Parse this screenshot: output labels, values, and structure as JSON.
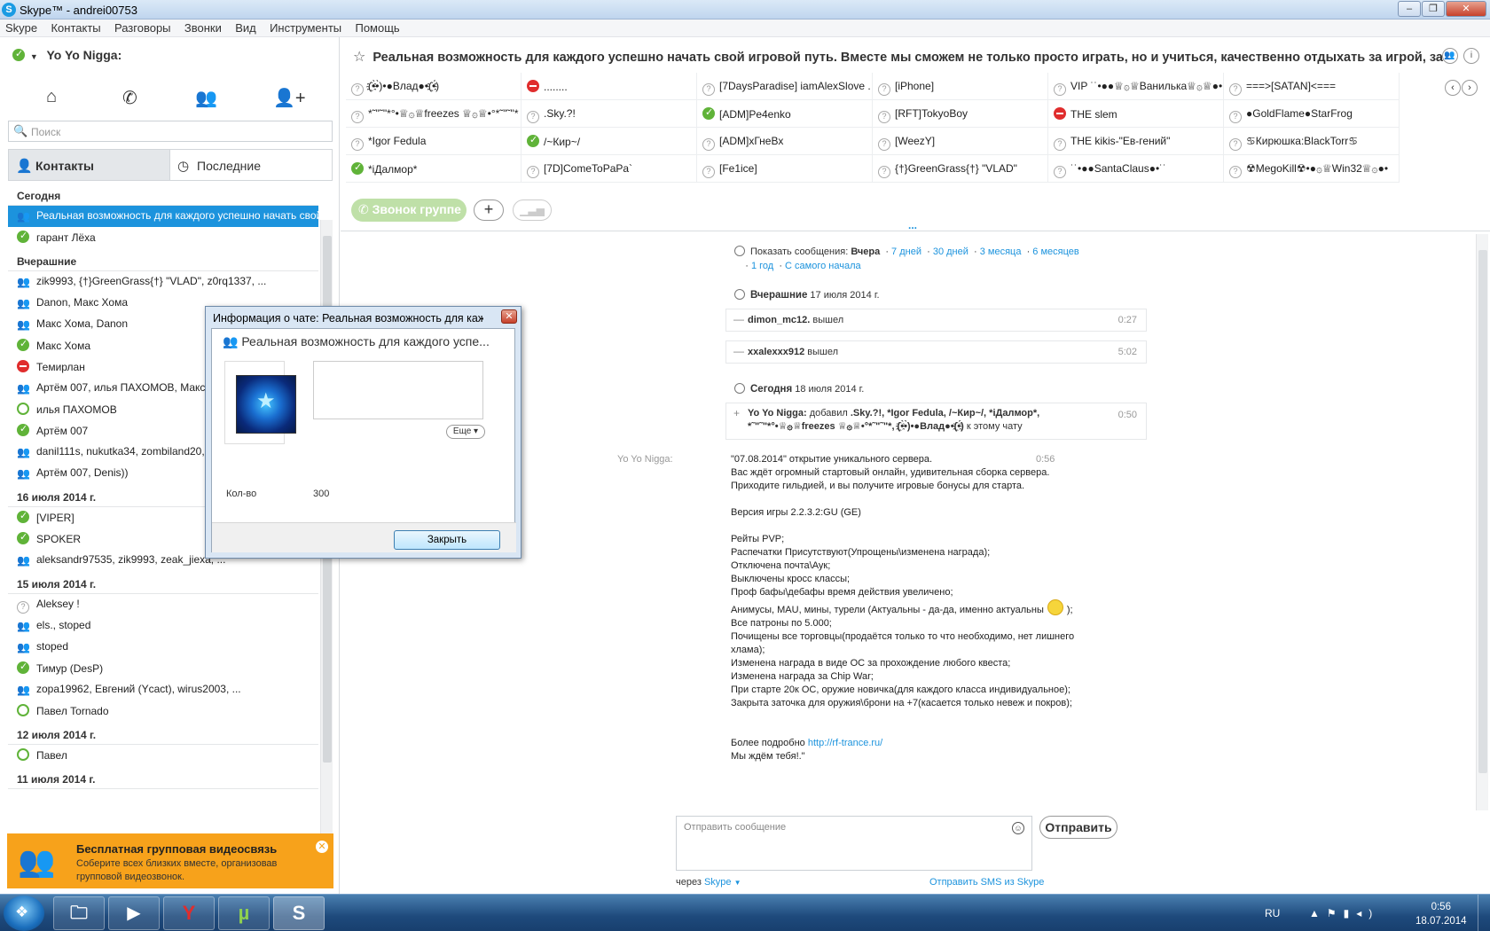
{
  "window": {
    "title": "Skype™ - andrei00753"
  },
  "menu": [
    "Skype",
    "Контакты",
    "Разговоры",
    "Звонки",
    "Вид",
    "Инструменты",
    "Помощь"
  ],
  "profile": {
    "name": "Yo Yo Nigga:"
  },
  "search": {
    "placeholder": "Поиск"
  },
  "tabs": {
    "contacts": "Контакты",
    "recent": "Последние"
  },
  "recent_list": [
    {
      "type": "header",
      "label": "Сегодня"
    },
    {
      "type": "row",
      "status": "group",
      "label": "Реальная возможность для каждого успешно начать свой...",
      "selected": true
    },
    {
      "type": "row",
      "status": "online",
      "label": "гарант Лёха"
    },
    {
      "type": "header",
      "label": "Вчерашние"
    },
    {
      "type": "row",
      "status": "group",
      "label": "zik9993, {†}GreenGrass{†} \"VLAD\", z0rq1337, ..."
    },
    {
      "type": "row",
      "status": "group",
      "label": "Danon, Макс Хома"
    },
    {
      "type": "row",
      "status": "group",
      "label": "Макс Хома, Danon"
    },
    {
      "type": "row",
      "status": "online",
      "label": "Макс Хома"
    },
    {
      "type": "row",
      "status": "busy",
      "label": "Темирлан"
    },
    {
      "type": "row",
      "status": "group",
      "label": "Артём 007, илья ПАХОМОВ, Макс Хома"
    },
    {
      "type": "row",
      "status": "offline",
      "label": "илья ПАХОМОВ"
    },
    {
      "type": "row",
      "status": "online",
      "label": "Артём 007"
    },
    {
      "type": "row",
      "status": "group",
      "label": "danil111s, nukutka34, zombiland20, ..."
    },
    {
      "type": "row",
      "status": "group",
      "label": "Артём 007, Denis))"
    },
    {
      "type": "header",
      "label": "16 июля 2014 г."
    },
    {
      "type": "row",
      "status": "online",
      "label": "[VIPER]"
    },
    {
      "type": "row",
      "status": "online",
      "label": "SPOKER"
    },
    {
      "type": "row",
      "status": "group",
      "label": "aleksandr97535, zik9993, zeak_jiexa, ..."
    },
    {
      "type": "header",
      "label": "15 июля 2014 г."
    },
    {
      "type": "row",
      "status": "unknown",
      "label": "Aleksey !"
    },
    {
      "type": "row",
      "status": "group",
      "label": "els., stoped"
    },
    {
      "type": "row",
      "status": "group",
      "label": "stoped"
    },
    {
      "type": "row",
      "status": "online",
      "label": "Тимур (DesP)"
    },
    {
      "type": "row",
      "status": "group",
      "label": "zopa19962, Евгений (Ycact), wirus2003, ..."
    },
    {
      "type": "row",
      "status": "offline",
      "label": "Павел Tornado"
    },
    {
      "type": "header",
      "label": "12 июля 2014 г."
    },
    {
      "type": "row",
      "status": "offline",
      "label": "Павел"
    },
    {
      "type": "header",
      "label": "11 июля 2014 г."
    }
  ],
  "promo": {
    "title": "Бесплатная групповая видеосвязь",
    "text": "Соберите всех близких вместе, организовав групповой видеозвонок."
  },
  "chat_topic": "Реальная возможность для каждого успешно начать свой игровой путь. Вместе мы сможем не только просто играть, но и учиться, качественно отдыхать за игрой, заводить з...",
  "members": [
    [
      {
        "s": "unknown",
        "n": "(҈•̀•̀)•●Влад●•(҈•́)"
      },
      {
        "s": "busy",
        "n": "........"
      },
      {
        "s": "unknown",
        "n": "[7DaysParadise] iamAlexSlove ."
      },
      {
        "s": "unknown",
        "n": "[iPhone]"
      },
      {
        "s": "unknown",
        "n": "VIP ˙˙•●●♕۞♕Ванилька♕۞♕●•"
      },
      {
        "s": "unknown",
        "n": "===>[SATAN]<==="
      }
    ],
    [
      {
        "s": "unknown",
        "n": "*˜\"˜\"*°•♕۞♕freezes ♕۞♕•°*˜\"˜\"*"
      },
      {
        "s": "unknown",
        "n": ".Sky.?!"
      },
      {
        "s": "online",
        "n": "[ADM]Pe4enko"
      },
      {
        "s": "unknown",
        "n": "[RFT]TokyoBoy"
      },
      {
        "s": "busy",
        "n": "THE slem"
      },
      {
        "s": "unknown",
        "n": "●GoldFlame●StarFrog"
      }
    ],
    [
      {
        "s": "unknown",
        "n": "*Igor Fedula"
      },
      {
        "s": "online",
        "n": "/~Кир~/"
      },
      {
        "s": "unknown",
        "n": "[ADM]хГнеВх"
      },
      {
        "s": "unknown",
        "n": "[WeezY]"
      },
      {
        "s": "unknown",
        "n": "THE kikis-\"Ев-гений\""
      },
      {
        "s": "unknown",
        "n": "♋Кирюшка:BlackTorr♋"
      }
    ],
    [
      {
        "s": "online",
        "n": "*iДалмор*"
      },
      {
        "s": "unknown",
        "n": "[7D]ComeToPaPa`"
      },
      {
        "s": "unknown",
        "n": "[Fe1ice]"
      },
      {
        "s": "unknown",
        "n": "{†}GreenGrass{†} \"VLAD\""
      },
      {
        "s": "unknown",
        "n": "˙˙•●●SantaClaus●•˙˙"
      },
      {
        "s": "unknown",
        "n": "☢MegoKill☢•●۞♕Win32♕۞●•"
      }
    ]
  ],
  "call": {
    "group_call": "Звонок группе"
  },
  "history": {
    "show_label": "Показать сообщения:",
    "current": "Вчера",
    "links": [
      "7 дней",
      "30 дней",
      "3 месяца",
      "6 месяцев",
      "1 год",
      "С самого начала"
    ]
  },
  "days": [
    {
      "label": "Вчерашние",
      "date": "17 июля 2014 г."
    },
    {
      "label": "Сегодня",
      "date": "18 июля 2014 г."
    }
  ],
  "events": [
    {
      "user": "dimon_mc12.",
      "action": "вышел",
      "time": "0:27"
    },
    {
      "user": "xxalexxx912",
      "action": "вышел",
      "time": "5:02"
    }
  ],
  "add_event": {
    "user": "Yo Yo Nigga:",
    "action": "добавил",
    "names_line1": ".Sky.?!, *Igor Fedula, /~Кир~/, *iДалмор*,",
    "names_line2": "*˜\"˜\"*°•♕۞♕freezes ♕۞♕•°*˜\"˜\"*, (҈•̀•̀)•●Влад●•(҈•́)",
    "tail": "к этому чату",
    "time": "0:50"
  },
  "message": {
    "sender": "Yo Yo Nigga:",
    "time": "0:56",
    "lines": [
      "\"07.08.2014\" открытие уникального сервера.",
      "Вас ждёт огромный стартовый онлайн, удивительная сборка сервера.",
      "Приходите гильдией, и вы получите игровые бонусы для старта.",
      "",
      "Версия игры 2.2.3.2:GU (GE)",
      "",
      "Рейты PVP;",
      "Распечатки Присутствуют(Упрощены\\изменена награда);",
      "Отключена почта\\Аук;",
      "Выключены кросс классы;",
      "Проф бафы\\дебафы время действия увеличено;",
      "Анимусы, MAU, мины, турели (Актуальны - да-да, именно актуальны",
      "Все патроны по 5.000;",
      "Почищены все торговцы(продаётся только то что необходимо, нет лишнего",
      "хлама);",
      "Изменена награда в виде ОС за прохождение любого квеста;",
      "Изменена награда за Chip War;",
      "При старте 20к ОС, оружие новичка(для каждого класса индивидуальное);",
      "Закрыта заточка для оружия\\брони на +7(касается только невеж и покров);",
      "",
      "",
      "",
      "Мы ждём тебя!.\""
    ],
    "smiley_suffix": ");",
    "more_prefix": "Более подробно",
    "link": "http://rf-trance.ru/"
  },
  "composer": {
    "placeholder": "Отправить сообщение",
    "send": "Отправить",
    "via": "через",
    "via_service": "Skype",
    "sms": "Отправить SMS из Skype"
  },
  "dialog": {
    "title": "Информация о чате: Реальная возможность для каждого...",
    "heading": "Реальная возможность для каждого успе...",
    "more": "Еще",
    "count_label": "Кол-во",
    "count_value": "300",
    "close": "Закрыть"
  },
  "taskbar": {
    "lang": "RU",
    "time": "0:56",
    "date": "18.07.2014"
  },
  "colors": {
    "accent": "#1c93dd",
    "online": "#60b339",
    "busy": "#e02d2d",
    "promo": "#f7a21b"
  }
}
